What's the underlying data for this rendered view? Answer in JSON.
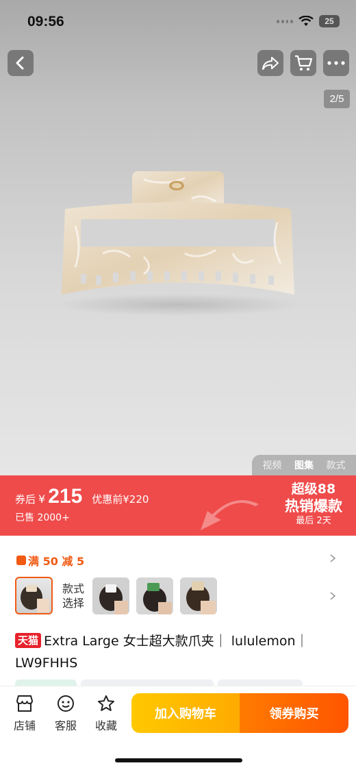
{
  "status": {
    "time": "09:56",
    "battery": "25"
  },
  "gallery": {
    "counter": "2/5",
    "tabs": [
      "视频",
      "图集",
      "款式"
    ],
    "active_tab": "图集"
  },
  "promo": {
    "after_label": "券后",
    "currency": "¥",
    "price": "215",
    "before_label": "优惠前¥220",
    "sold": "已售 2000+",
    "event_line1": "超级88",
    "event_line2": "热销爆款",
    "event_line3": "最后 2天"
  },
  "coupon": {
    "text": "满 50 减 5"
  },
  "style": {
    "label_line1": "款式",
    "label_line2": "选择"
  },
  "product": {
    "badge": "天猫",
    "title": "Extra Large 女士超大款爪夹｜ lululemon｜ LW9FHHS"
  },
  "bottom": {
    "store": "店铺",
    "service": "客服",
    "favorite": "收藏",
    "add_to_cart": "加入购物车",
    "buy": "领券购买"
  },
  "colors": {
    "promo_red": "#ef4b4b",
    "orange": "#f05a13",
    "cart_yellow": "#ffc000",
    "buy_orange": "#ff6a00",
    "tmall_red": "#e8212b"
  }
}
